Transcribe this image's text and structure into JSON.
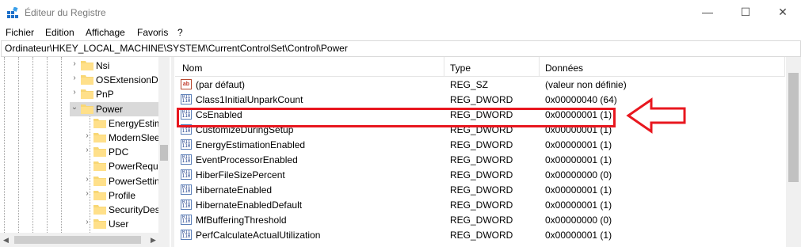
{
  "window": {
    "title": "Éditeur du Registre",
    "minimize_glyph": "—",
    "maximize_glyph": "☐",
    "close_glyph": "✕"
  },
  "menu": [
    "Fichier",
    "Edition",
    "Affichage",
    "Favoris",
    "?"
  ],
  "address": "Ordinateur\\HKEY_LOCAL_MACHINE\\SYSTEM\\CurrentControlSet\\Control\\Power",
  "tree": {
    "items": [
      {
        "label": "Nsi",
        "level": 1,
        "expander": "›",
        "selected": false
      },
      {
        "label": "OSExtensionD",
        "level": 1,
        "expander": "›",
        "selected": false
      },
      {
        "label": "PnP",
        "level": 1,
        "expander": "›",
        "selected": false
      },
      {
        "label": "Power",
        "level": 1,
        "expander": "⌄",
        "selected": true
      },
      {
        "label": "EnergyEstim",
        "level": 2,
        "expander": "",
        "selected": false
      },
      {
        "label": "ModernSlee",
        "level": 2,
        "expander": "›",
        "selected": false
      },
      {
        "label": "PDC",
        "level": 2,
        "expander": "›",
        "selected": false
      },
      {
        "label": "PowerRequ",
        "level": 2,
        "expander": "",
        "selected": false
      },
      {
        "label": "PowerSettin",
        "level": 2,
        "expander": "›",
        "selected": false
      },
      {
        "label": "Profile",
        "level": 2,
        "expander": "›",
        "selected": false
      },
      {
        "label": "SecurityDes",
        "level": 2,
        "expander": "",
        "selected": false
      },
      {
        "label": "User",
        "level": 2,
        "expander": "›",
        "selected": false
      }
    ]
  },
  "list": {
    "columns": {
      "name": "Nom",
      "type": "Type",
      "data": "Données"
    },
    "rows": [
      {
        "name": "(par défaut)",
        "type": "REG_SZ",
        "data": "(valeur non définie)",
        "icon": "string-value-icon"
      },
      {
        "name": "Class1InitialUnparkCount",
        "type": "REG_DWORD",
        "data": "0x00000040 (64)",
        "icon": "binary-value-icon"
      },
      {
        "name": "CsEnabled",
        "type": "REG_DWORD",
        "data": "0x00000001 (1)",
        "icon": "binary-value-icon"
      },
      {
        "name": "CustomizeDuringSetup",
        "type": "REG_DWORD",
        "data": "0x00000001 (1)",
        "icon": "binary-value-icon"
      },
      {
        "name": "EnergyEstimationEnabled",
        "type": "REG_DWORD",
        "data": "0x00000001 (1)",
        "icon": "binary-value-icon"
      },
      {
        "name": "EventProcessorEnabled",
        "type": "REG_DWORD",
        "data": "0x00000001 (1)",
        "icon": "binary-value-icon"
      },
      {
        "name": "HiberFileSizePercent",
        "type": "REG_DWORD",
        "data": "0x00000000 (0)",
        "icon": "binary-value-icon"
      },
      {
        "name": "HibernateEnabled",
        "type": "REG_DWORD",
        "data": "0x00000001 (1)",
        "icon": "binary-value-icon"
      },
      {
        "name": "HibernateEnabledDefault",
        "type": "REG_DWORD",
        "data": "0x00000001 (1)",
        "icon": "binary-value-icon"
      },
      {
        "name": "MfBufferingThreshold",
        "type": "REG_DWORD",
        "data": "0x00000000 (0)",
        "icon": "binary-value-icon"
      },
      {
        "name": "PerfCalculateActualUtilization",
        "type": "REG_DWORD",
        "data": "0x00000001 (1)",
        "icon": "binary-value-icon"
      }
    ]
  },
  "annotation": {
    "highlight_color": "#e8171f",
    "highlighted_row": "CsEnabled"
  }
}
